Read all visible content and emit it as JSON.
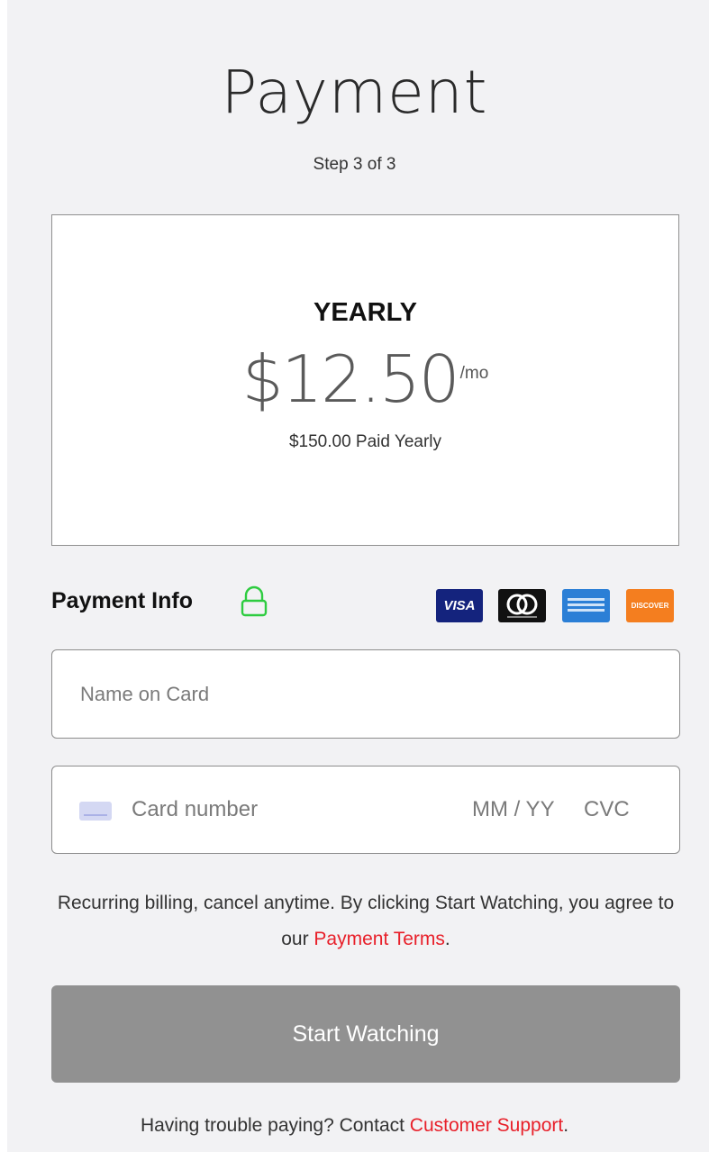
{
  "header": {
    "title": "Payment",
    "step": "Step 3 of 3"
  },
  "plan": {
    "name": "YEARLY",
    "price": "$12.50",
    "per": "/mo",
    "billed": "$150.00 Paid Yearly"
  },
  "payment_info": {
    "label": "Payment Info",
    "lock_icon": "lock-icon",
    "lock_color": "#2ecc40",
    "card_logos": [
      {
        "name": "visa",
        "text": "VISA"
      },
      {
        "name": "mastercard",
        "text": ""
      },
      {
        "name": "amex",
        "text": ""
      },
      {
        "name": "discover",
        "text": "DISCOVER"
      }
    ]
  },
  "form": {
    "name_placeholder": "Name on Card",
    "card_number_placeholder": "Card number",
    "expiry_placeholder": "MM / YY",
    "cvc_placeholder": "CVC"
  },
  "terms": {
    "text_before": "Recurring billing, cancel anytime. By clicking Start Watching, you agree to our ",
    "link": "Payment Terms",
    "text_after": "."
  },
  "actions": {
    "start_label": "Start Watching"
  },
  "support": {
    "text_before": "Having trouble paying? Contact ",
    "link": "Customer Support",
    "text_after": "."
  },
  "colors": {
    "link": "#e8202a",
    "button_disabled": "#919191",
    "background": "#f2f2f4"
  }
}
